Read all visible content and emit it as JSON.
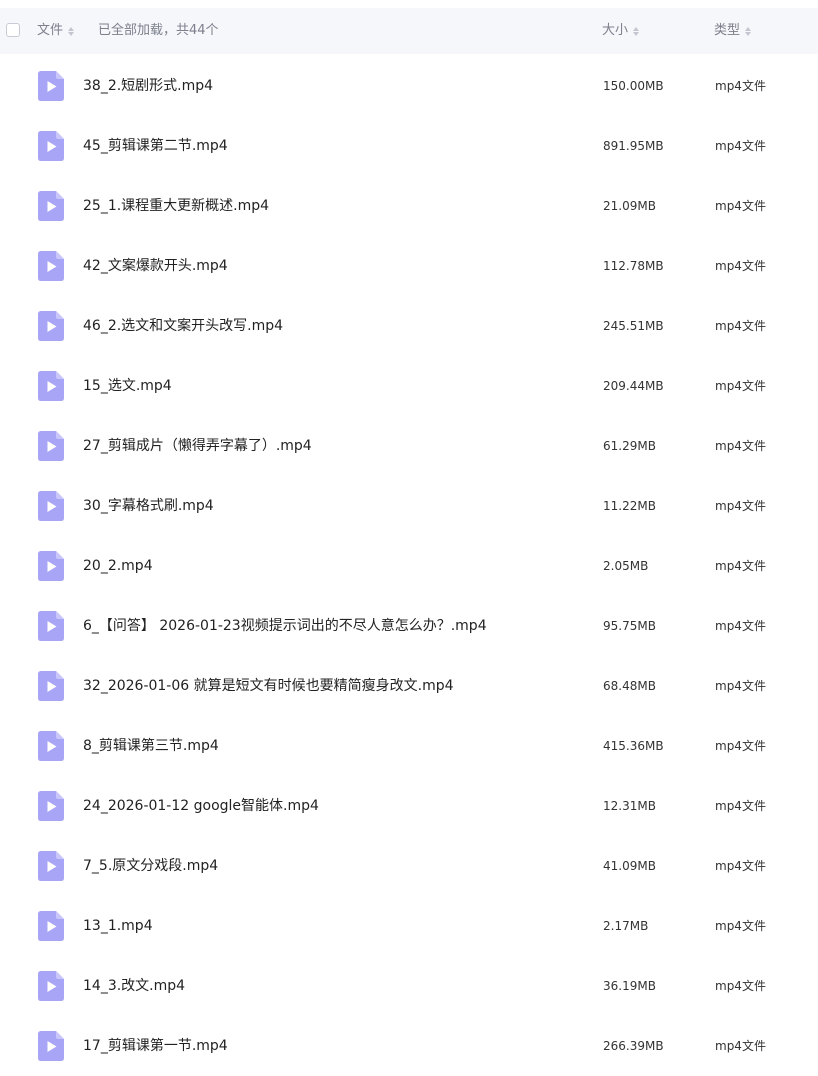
{
  "header": {
    "name_label": "文件",
    "status_text": "已全部加载，共44个",
    "size_label": "大小",
    "type_label": "类型"
  },
  "colors": {
    "icon_accent": "#a8a4f6",
    "header_bg": "#f6f7fb"
  },
  "icons": {
    "file": "video-file-icon"
  },
  "files": [
    {
      "name": "38_2.短剧形式.mp4",
      "size": "150.00MB",
      "type": "mp4文件"
    },
    {
      "name": "45_剪辑课第二节.mp4",
      "size": "891.95MB",
      "type": "mp4文件"
    },
    {
      "name": "25_1.课程重大更新概述.mp4",
      "size": "21.09MB",
      "type": "mp4文件"
    },
    {
      "name": "42_文案爆款开头.mp4",
      "size": "112.78MB",
      "type": "mp4文件"
    },
    {
      "name": "46_2.选文和文案开头改写.mp4",
      "size": "245.51MB",
      "type": "mp4文件"
    },
    {
      "name": "15_选文.mp4",
      "size": "209.44MB",
      "type": "mp4文件"
    },
    {
      "name": "27_剪辑成片（懒得弄字幕了）.mp4",
      "size": "61.29MB",
      "type": "mp4文件"
    },
    {
      "name": "30_字幕格式刷.mp4",
      "size": "11.22MB",
      "type": "mp4文件"
    },
    {
      "name": "20_2.mp4",
      "size": "2.05MB",
      "type": "mp4文件"
    },
    {
      "name": "6_【问答】 2026-01-23视频提示词出的不尽人意怎么办？.mp4",
      "size": "95.75MB",
      "type": "mp4文件"
    },
    {
      "name": "32_2026-01-06 就算是短文有时候也要精简瘦身改文.mp4",
      "size": "68.48MB",
      "type": "mp4文件"
    },
    {
      "name": "8_剪辑课第三节.mp4",
      "size": "415.36MB",
      "type": "mp4文件"
    },
    {
      "name": "24_2026-01-12 google智能体.mp4",
      "size": "12.31MB",
      "type": "mp4文件"
    },
    {
      "name": "7_5.原文分戏段.mp4",
      "size": "41.09MB",
      "type": "mp4文件"
    },
    {
      "name": "13_1.mp4",
      "size": "2.17MB",
      "type": "mp4文件"
    },
    {
      "name": "14_3.改文.mp4",
      "size": "36.19MB",
      "type": "mp4文件"
    },
    {
      "name": "17_剪辑课第一节.mp4",
      "size": "266.39MB",
      "type": "mp4文件"
    }
  ]
}
